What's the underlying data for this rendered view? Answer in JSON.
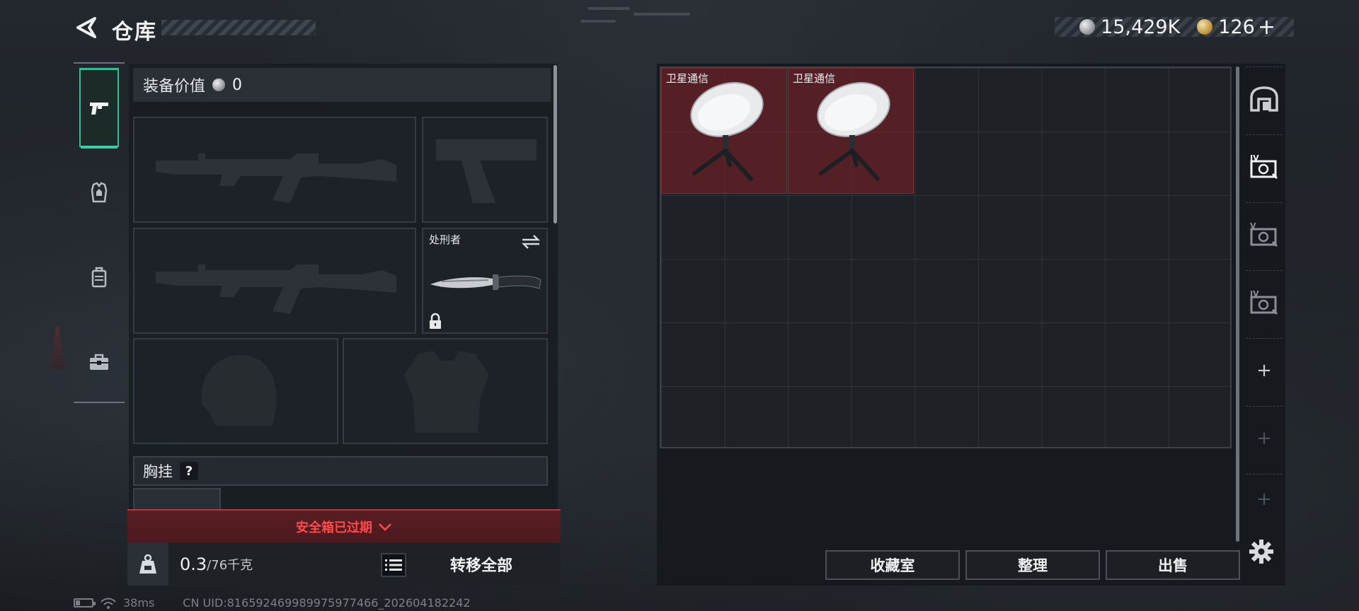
{
  "header": {
    "title": "仓库"
  },
  "currency": {
    "coins": "15,429K",
    "tickets": "126",
    "tickets_plus": "+"
  },
  "loadout": {
    "value_label": "装备价值",
    "value": "0",
    "melee_name": "处刑者",
    "rig_label": "胸挂",
    "rig_help": "?",
    "warning": "安全箱已过期",
    "weight_current": "0.3",
    "weight_max": "/76千克",
    "transfer_all": "转移全部"
  },
  "storage": {
    "items": [
      {
        "name": "卫星通信"
      },
      {
        "name": "卫星通信"
      }
    ],
    "buttons": {
      "collection": "收藏室",
      "sort": "整理",
      "sell": "出售"
    }
  },
  "status": {
    "ping": "38ms",
    "uid": "CN UID:816592469989975977466_202604182242"
  },
  "icons": [
    "back-icon",
    "pistol-icon",
    "armor-vest-icon",
    "backpack-icon",
    "toolbox-icon",
    "silver-coin-icon",
    "gold-coin-icon",
    "lock-icon",
    "swap-icon",
    "chevron-down-icon",
    "kg-weight-icon",
    "list-icon",
    "gear-icon",
    "safehouse-icon",
    "case-iv-icon",
    "case-v-icon"
  ],
  "colors": {
    "accent": "#34d2a4",
    "warning": "#ff4a4a",
    "item_bg": "#782026"
  }
}
